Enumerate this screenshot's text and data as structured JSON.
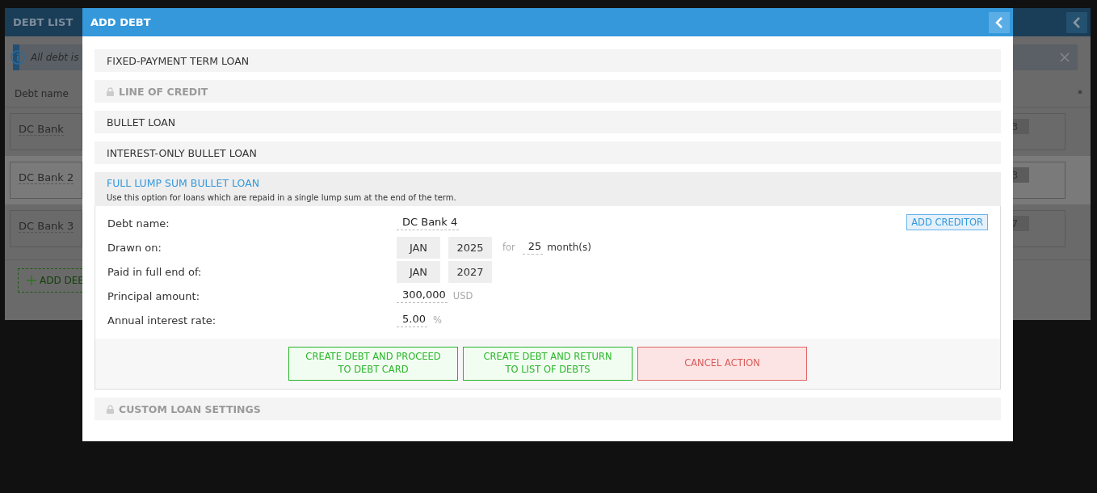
{
  "background": {
    "title": "DEBT LIST",
    "notice": "All debt is",
    "column_1": "Debt name",
    "column_2": "*",
    "rows": [
      {
        "name": "DC Bank",
        "column_2": "3",
        "selected": false
      },
      {
        "name": "DC Bank 2",
        "column_2": "3",
        "selected": true
      },
      {
        "name": "DC Bank 3",
        "column_2": "7",
        "selected": false
      }
    ],
    "add_button": "ADD DEB"
  },
  "dialog": {
    "title": "ADD DEBT",
    "options": [
      {
        "label": "FIXED-PAYMENT TERM LOAN",
        "locked": false,
        "expanded": false
      },
      {
        "label": "LINE OF CREDIT",
        "locked": true,
        "expanded": false
      },
      {
        "label": "BULLET LOAN",
        "locked": false,
        "expanded": false
      },
      {
        "label": "INTEREST-ONLY BULLET LOAN",
        "locked": false,
        "expanded": false
      },
      {
        "label": "FULL LUMP SUM BULLET LOAN",
        "expanded": true,
        "description": "Use this option for loans which are repaid in a single lump sum at the end of the term."
      },
      {
        "label": "CUSTOM LOAN SETTINGS",
        "locked": true,
        "expanded": false
      }
    ],
    "add_creditor": "ADD CREDITOR",
    "fields": [
      {
        "kind": "text",
        "label": "Debt name:",
        "value": "DC Bank 4"
      },
      {
        "kind": "period",
        "label": "Drawn on:",
        "month": "JAN",
        "year": "2025",
        "for": "for",
        "count": "25",
        "unit": "month(s)"
      },
      {
        "kind": "date",
        "label": "Paid in full end of:",
        "month": "JAN",
        "year": "2027"
      },
      {
        "kind": "amount",
        "label": "Principal amount:",
        "value": "300,000",
        "unit": "USD"
      },
      {
        "kind": "amount",
        "label": "Annual interest rate:",
        "value": "5.00",
        "unit": "%"
      }
    ],
    "buttons": [
      {
        "kind": "confirm",
        "label": "CREATE DEBT AND PROCEED TO DEBT CARD"
      },
      {
        "kind": "confirm",
        "label": "CREATE DEBT AND RETURN TO LIST OF DEBTS"
      },
      {
        "kind": "cancel",
        "label": "CANCEL ACTION"
      }
    ]
  }
}
